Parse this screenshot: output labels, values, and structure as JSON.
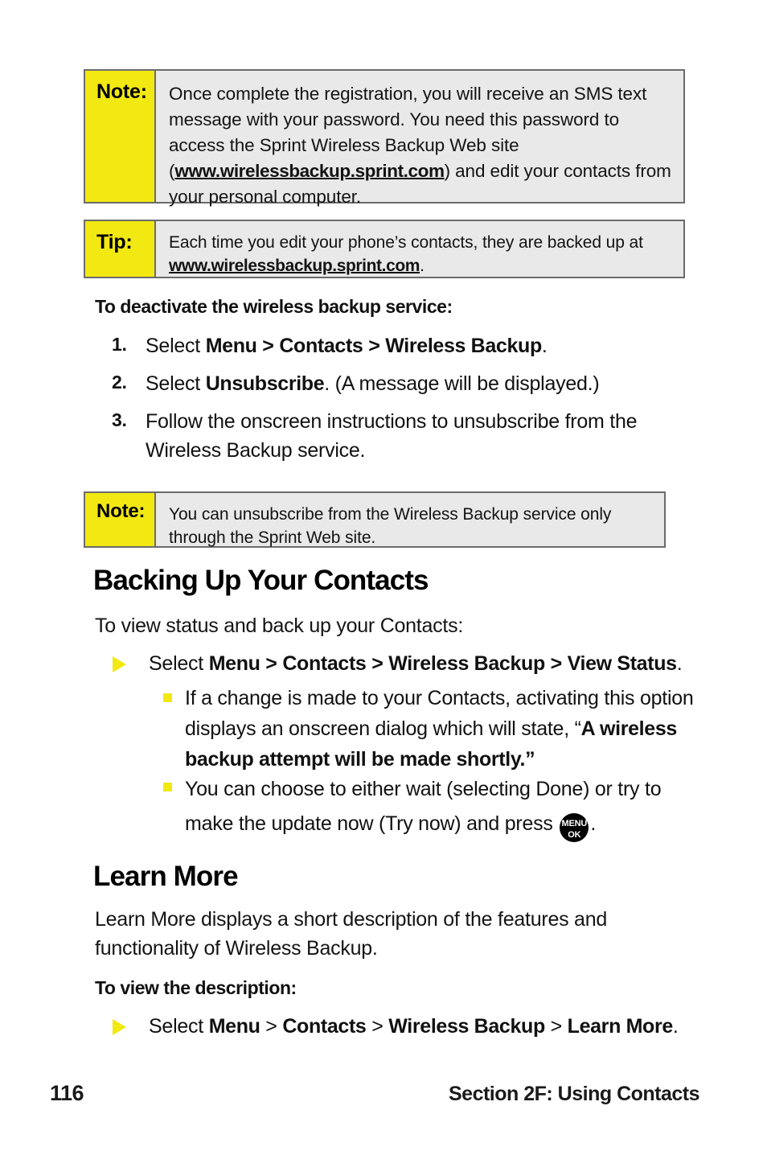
{
  "colors": {
    "accent_yellow": "#f2e812",
    "callout_body_bg": "#e9e9e9",
    "callout_border": "#6b6b6b",
    "text": "#111111",
    "key_glyph_bg": "#000000"
  },
  "callouts": {
    "note1": {
      "label": "Note:",
      "text_before_url": "Once complete the registration, you will receive an SMS text message with your password. You need this password to access the Sprint Wireless Backup Web site (",
      "url": "www.wirelessbackup.sprint.com",
      "text_after_url": ") and edit your contacts from your personal computer."
    },
    "tip": {
      "label": "Tip:",
      "text_before_url": "Each time you edit your phone’s contacts, they are backed up at ",
      "url": "www.wirelessbackup.sprint.com",
      "text_after_url": "."
    },
    "note2": {
      "label": "Note:",
      "text": "You can unsubscribe from the Wireless Backup service only through the Sprint Web site."
    }
  },
  "deactivate": {
    "heading": "To deactivate the wireless backup service:",
    "steps": [
      {
        "number": "1.",
        "lead": "Select ",
        "path": [
          "Menu",
          "Contacts",
          "Wireless Backup"
        ],
        "separator": ">",
        "trail": "."
      },
      {
        "number": "2.",
        "lead": "Select ",
        "bold": "Unsubscribe",
        "trail": ". (A message will be displayed.)"
      },
      {
        "number": "3.",
        "text": "Follow the onscreen instructions to unsubscribe from the Wireless Backup service."
      }
    ]
  },
  "backing_up": {
    "heading": "Backing Up Your Contacts",
    "intro": "To view status and back up your Contacts:",
    "bullet": {
      "lead": "Select ",
      "path": [
        "Menu",
        "Contacts",
        "Wireless Backup",
        "View Status"
      ],
      "separator": ">",
      "trail": "."
    },
    "sub_bullets": [
      {
        "text": "If a change is made to your Contacts, activating this option displays an onscreen dialog which will state, ",
        "quote_open": "“",
        "quote_bold": "A wireless backup attempt will be made shortly.",
        "quote_close": "”"
      },
      {
        "text_before_key": "You can choose to either wait (selecting Done) or try to make the update now (Try now) and press ",
        "key_glyph": {
          "line1": "MENU",
          "line2": "OK"
        },
        "text_after_key": "."
      }
    ]
  },
  "learn_more": {
    "heading": "Learn More",
    "paragraph": "Learn More displays a short description of the features and functionality of Wireless Backup.",
    "subhead": "To view the description:",
    "bullet": {
      "lead": "Select ",
      "path": [
        "Menu",
        "Contacts",
        "Wireless Backup",
        "Learn More"
      ],
      "separator": ">",
      "trail": "."
    }
  },
  "footer": {
    "page_number": "116",
    "section": "Section 2F: Using Contacts"
  }
}
